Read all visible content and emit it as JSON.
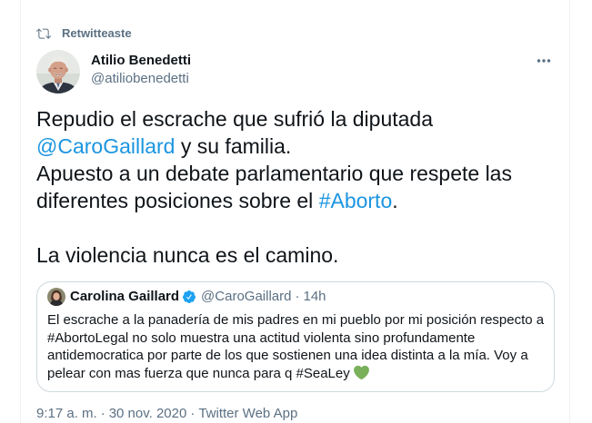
{
  "colors": {
    "text": "#0f1419",
    "secondary": "#5b7083",
    "link": "#1b95e0",
    "verified": "#1da1f2",
    "heart": "#78b159",
    "border": "#cfd9de"
  },
  "social_context": {
    "icon": "retweet-icon",
    "label": "Retwitteaste"
  },
  "author": {
    "avatar": "author-avatar",
    "name": "Atilio Benedetti",
    "handle": "@atiliobenedetti",
    "more_icon": "more-options-icon"
  },
  "tweet": {
    "text_1": "Repudio el escrache que sufrió la diputada ",
    "mention": "@CaroGaillard",
    "text_2": " y su familia.\nApuesto a un debate parlamentario que respete las diferentes posiciones sobre el ",
    "hashtag": "#Aborto",
    "text_3": ".\n\nLa violencia nunca es el camino."
  },
  "quoted_tweet": {
    "avatar": "quoted-author-avatar",
    "name": "Carolina Gaillard",
    "verified_icon": "verified-badge-icon",
    "handle": "@CaroGaillard",
    "separator": "·",
    "time": "14h",
    "text": "El escrache a la panadería de mis padres en mi pueblo por mi posición respecto a #AbortoLegal no solo muestra una actitud violenta sino profundamente antidemocratica por parte de los que sostienen una idea distinta a la mía. Voy a pelear con mas fuerza que nunca para q #SeaLey",
    "emoji_icon": "green-heart-icon"
  },
  "footer": {
    "time": "9:17 a. m.",
    "separator": "·",
    "date": "30 nov. 2020",
    "source": "Twitter Web App"
  }
}
